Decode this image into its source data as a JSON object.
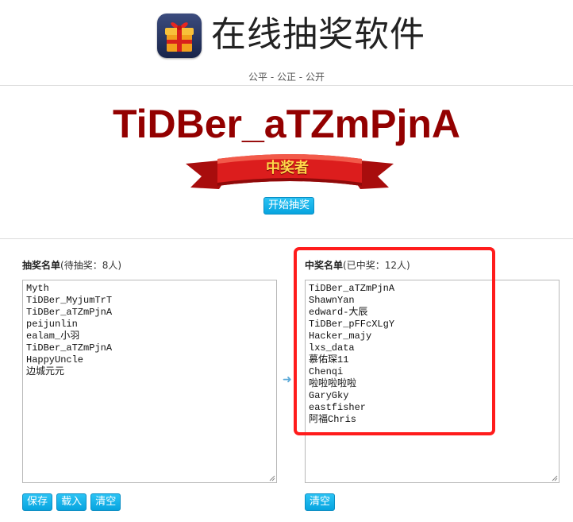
{
  "header": {
    "title": "在线抽奖软件",
    "slogan": "公平 - 公正 - 公开",
    "logo_icon": "gift-box-icon"
  },
  "winner": {
    "name": "TiDBer_aTZmPjnA",
    "banner_text": "中奖者",
    "start_label": "开始抽奖"
  },
  "pool": {
    "title": "抽奖名单",
    "status": "(待抽奖：8人)",
    "entries": [
      "Myth",
      "TiDBer_MyjumTrT",
      "TiDBer_aTZmPjnA",
      "peijunlin",
      "ealam_小羽",
      "TiDBer_aTZmPjnA",
      "HappyUncle",
      "边城元元"
    ],
    "buttons": {
      "save": "保存",
      "load": "载入",
      "clear": "清空"
    }
  },
  "winners": {
    "title": "中奖名单",
    "status": "(已中奖：12人)",
    "entries": [
      "TiDBer_aTZmPjnA",
      "ShawnYan",
      "edward-大辰",
      "TiDBer_pFFcXLgY",
      "Hacker_majy",
      "lxs_data",
      "慕佑琛11",
      "Chenqi",
      "啦啦啦啦啦",
      "GaryGky",
      "eastfisher",
      "阿福Chris"
    ],
    "buttons": {
      "clear": "清空"
    }
  },
  "colors": {
    "winner_name": "#930000",
    "button": "#07a4df",
    "highlight": "#ff1c1c"
  }
}
